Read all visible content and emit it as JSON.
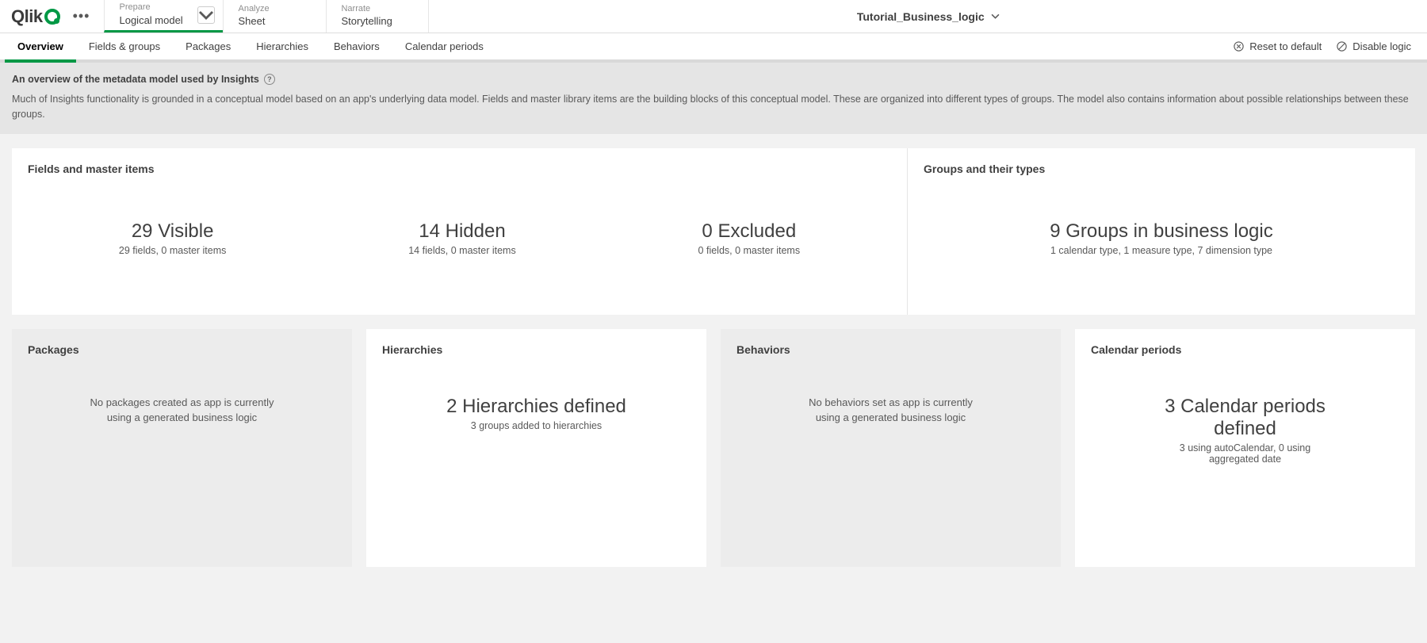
{
  "logo_text": "Qlik",
  "nav": {
    "prepare": {
      "top": "Prepare",
      "bot": "Logical model"
    },
    "analyze": {
      "top": "Analyze",
      "bot": "Sheet"
    },
    "narrate": {
      "top": "Narrate",
      "bot": "Storytelling"
    }
  },
  "app_title": "Tutorial_Business_logic",
  "subnav": {
    "overview": "Overview",
    "fields": "Fields & groups",
    "packages": "Packages",
    "hierarchies": "Hierarchies",
    "behaviors": "Behaviors",
    "calendar": "Calendar periods",
    "reset": "Reset to default",
    "disable": "Disable logic"
  },
  "desc": {
    "title": "An overview of the metadata model used by Insights",
    "body": "Much of Insights functionality is grounded in a conceptual model based on an app's underlying data model. Fields and master library items are the building blocks of this conceptual model. These are organized into different types of groups. The model also contains information about possible relationships between these groups."
  },
  "fields_card": {
    "title": "Fields and master items",
    "stats": [
      {
        "big": "29 Visible",
        "sub": "29 fields, 0 master items"
      },
      {
        "big": "14 Hidden",
        "sub": "14 fields, 0 master items"
      },
      {
        "big": "0 Excluded",
        "sub": "0 fields, 0 master items"
      }
    ]
  },
  "groups_card": {
    "title": "Groups and their types",
    "big": "9 Groups in business logic",
    "sub": "1 calendar type, 1 measure type, 7 dimension type"
  },
  "packages_card": {
    "title": "Packages",
    "msg": "No packages created as app is currently using a generated business logic"
  },
  "hierarchies_card": {
    "title": "Hierarchies",
    "big": "2 Hierarchies defined",
    "sub": "3 groups added to hierarchies"
  },
  "behaviors_card": {
    "title": "Behaviors",
    "msg": "No behaviors set as app is currently using a generated business logic"
  },
  "calendar_card": {
    "title": "Calendar periods",
    "big": "3 Calendar periods defined",
    "sub": "3 using autoCalendar, 0 using aggregated date"
  }
}
